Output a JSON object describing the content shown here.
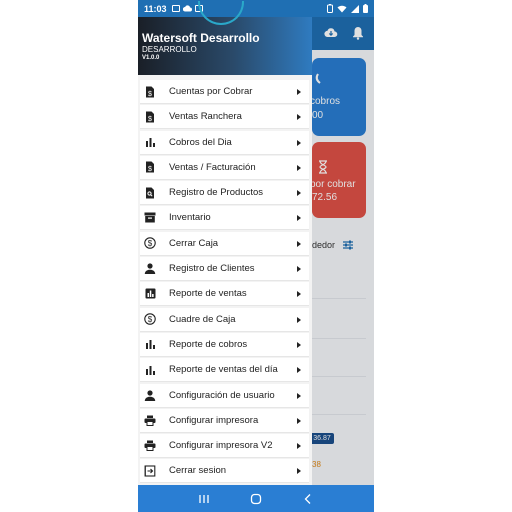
{
  "status_bar": {
    "time": "11:03"
  },
  "background": {
    "card_blue": {
      "label": "cobros",
      "value": "00"
    },
    "card_red": {
      "label": "por cobrar",
      "value": "72.56"
    },
    "row_text": "dedor",
    "badge_value": "36.87",
    "orange_text": "38"
  },
  "drawer": {
    "app_name": "Watersoft Desarrollo",
    "environment": "DESARROLLO",
    "version": "V1.0.0",
    "menu_items": [
      {
        "label": "Cuentas por Cobrar",
        "icon": "invoice-dollar-icon"
      },
      {
        "label": "Ventas Ranchera",
        "icon": "invoice-dollar-icon"
      },
      {
        "label": "Cobros del Dia",
        "icon": "bar-chart-icon"
      },
      {
        "label": "Ventas / Facturación",
        "icon": "invoice-dollar-icon"
      },
      {
        "label": "Registro de Productos",
        "icon": "document-search-icon"
      },
      {
        "label": "Inventario",
        "icon": "archive-box-icon"
      },
      {
        "label": "Cerrar Caja",
        "icon": "dollar-circle-icon"
      },
      {
        "label": "Registro de Clientes",
        "icon": "person-icon"
      },
      {
        "label": "Reporte de ventas",
        "icon": "bar-chart-box-icon"
      },
      {
        "label": "Cuadre de Caja",
        "icon": "dollar-circle-icon"
      },
      {
        "label": "Reporte de cobros",
        "icon": "bar-chart-icon"
      },
      {
        "label": "Reporte de ventas del día",
        "icon": "bar-chart-icon"
      },
      {
        "label": "Configuración de usuario",
        "icon": "person-icon"
      },
      {
        "label": "Configurar impresora",
        "icon": "printer-icon"
      },
      {
        "label": "Configurar impresora V2",
        "icon": "printer-icon"
      },
      {
        "label": "Cerrar sesion",
        "icon": "logout-icon"
      }
    ]
  },
  "colors": {
    "primary": "#1f6fb3",
    "accent": "#2a7ed3",
    "danger": "#e05147"
  }
}
